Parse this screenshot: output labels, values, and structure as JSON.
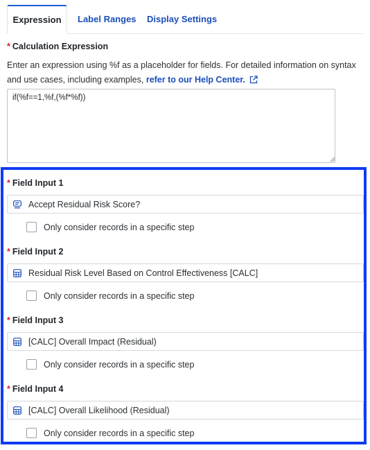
{
  "tabs": [
    {
      "label": "Expression",
      "active": true
    },
    {
      "label": "Label Ranges",
      "active": false
    },
    {
      "label": "Display Settings",
      "active": false
    }
  ],
  "calc": {
    "required_mark": "*",
    "label": "Calculation Expression",
    "help_text": "Enter an expression using %f as a placeholder for fields. For detailed information on syntax and use cases, including examples,",
    "help_link": "refer to our Help Center.",
    "expression_value": "if(%f==1,%f,(%f*%f))"
  },
  "fields": [
    {
      "label": "Field Input 1",
      "value": "Accept Residual Risk Score?",
      "icon": "list-field-icon",
      "checkbox_label": "Only consider records in a specific step",
      "checked": false
    },
    {
      "label": "Field Input 2",
      "value": "Residual Risk Level Based on Control Effectiveness [CALC]",
      "icon": "calculator-icon",
      "checkbox_label": "Only consider records in a specific step",
      "checked": false
    },
    {
      "label": "Field Input 3",
      "value": "[CALC] Overall Impact (Residual)",
      "icon": "calculator-icon",
      "checkbox_label": "Only consider records in a specific step",
      "checked": false
    },
    {
      "label": "Field Input 4",
      "value": "[CALC] Overall Likelihood (Residual)",
      "icon": "calculator-icon",
      "checkbox_label": "Only consider records in a specific step",
      "checked": false
    }
  ],
  "colors": {
    "accent": "#1b4fb8",
    "highlight": "#0f3bf5",
    "required": "#d8202a"
  }
}
